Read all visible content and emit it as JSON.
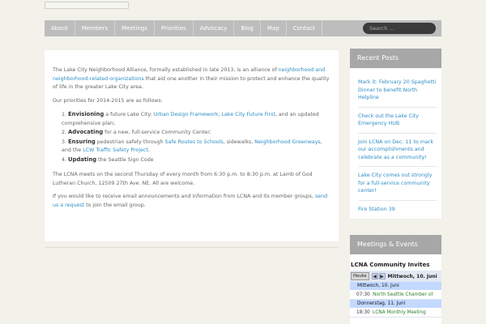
{
  "nav": {
    "items": [
      "About",
      "Members",
      "Meetings",
      "Priorities",
      "Advocacy",
      "Blog",
      "Map",
      "Contact"
    ],
    "search_placeholder": "Search ..."
  },
  "main": {
    "intro_pre": "The Lake City Neighborhood Alliance, formally established in late 2013, is an alliance of ",
    "intro_link": "neighborhood and neighborhood-related organizations",
    "intro_post": " that aid one another in their mission to protect and enhance the quality of life in the greater Lake City area.",
    "priorities_lead": "Our priorities for 2014-2015 are as follows:",
    "p1_num": "1.",
    "p1_bold": "Envisioning",
    "p1_text": " a future Lake City: ",
    "p1_link1": "Urban Design Framework",
    "p1_sep": "; ",
    "p1_link2": "Lake City Future First",
    "p1_tail": ", and an updated comprehensive plan;",
    "p2_num": "2.",
    "p2_bold": "Advocating",
    "p2_text": " for a new, full-service Community Center;",
    "p3_num": "3.",
    "p3_bold": "Ensuring",
    "p3_text": " pedestrian safety through ",
    "p3_link1": "Safe Routes to Schools",
    "p3_mid": ", sidewalks, ",
    "p3_link2": "Neighborhood Greenways",
    "p3_and": ", and the ",
    "p3_link3": "LCW Traffic Safety Project",
    "p3_end": ".",
    "p4_num": "4.",
    "p4_bold": "Updating",
    "p4_text": " the Seattle Sign Code",
    "meets": "The LCNA meets on the second Thursday of every month from 6:30 p.m. to 8:30 p.m. at Lamb of God Lutheran Church, 12509 27th Ave. NE. All are welcome.",
    "email_pre": "If you would like to receive email announcements and information from LCNA and its member groups, ",
    "email_link": "send us a request",
    "email_post": " to join the email group."
  },
  "recent_posts": {
    "title": "Recent Posts",
    "items": [
      "Mark it: February 20 Spaghetti Dinner to benefit North Helpline",
      "Check out the Lake City Emergency HUB",
      "Join LCNA on Dec. 11 to mark our accomplishments and celebrate as a community!",
      "Lake City comes out strongly for a full-service community center!",
      "Fire Station 39"
    ]
  },
  "events": {
    "title": "Meetings & Events",
    "calendar_title": "LCNA Community Invites",
    "today_label": "Heute",
    "prev_icon": "◀",
    "next_icon": "▶",
    "range": "Mittwoch, 10. Juni",
    "days": [
      {
        "label": "Mittwoch, 10. Juni",
        "events": [
          {
            "time": "07:30",
            "title": "North Seattle Chamber of"
          }
        ]
      },
      {
        "label": "Donnerstag, 11. Juni",
        "events": [
          {
            "time": "18:30",
            "title": "LCNA Monthly Meeting"
          }
        ]
      }
    ]
  },
  "colors": {
    "link": "#2f8ec5",
    "nav_bg": "#bdbdbd",
    "widget_head": "#a7a7a7",
    "event_green": "#2c7e2a"
  }
}
